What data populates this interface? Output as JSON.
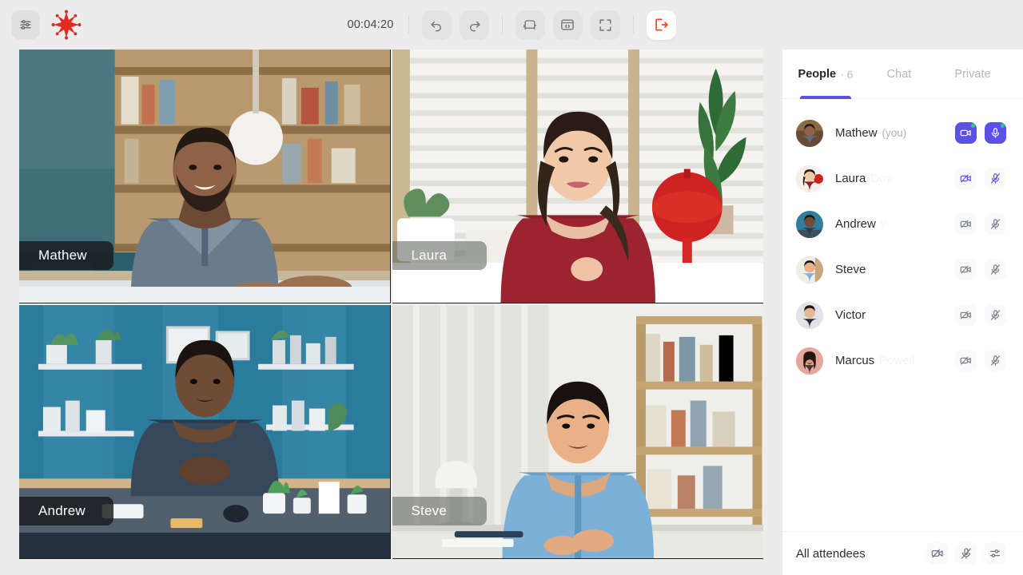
{
  "toolbar": {
    "settings_icon": "sliders-icon",
    "logo_icon": "brand-logo-icon",
    "timer": "00:04:20",
    "undo_label": "undo-icon",
    "redo_label": "redo-icon",
    "lounge_label": "sofa-icon",
    "embed_label": "code-window-icon",
    "fullscreen_label": "fullscreen-icon",
    "exit_label": "exit-icon",
    "accent_red": "#f4421a",
    "logo_red": "#e02b20"
  },
  "stage": {
    "tiles": [
      {
        "name": "Mathew",
        "pill_style": "dark"
      },
      {
        "name": "Laura",
        "pill_style": "translucent"
      },
      {
        "name": "Andrew",
        "pill_style": "dark"
      },
      {
        "name": "Steve",
        "pill_style": "translucent"
      }
    ]
  },
  "panel": {
    "tabs": [
      {
        "label": "People",
        "count": "· 6",
        "active": true
      },
      {
        "label": "Chat",
        "count": "",
        "active": false
      },
      {
        "label": "Private",
        "count": "",
        "active": false
      }
    ],
    "accent_purple": "#5b50e8",
    "people": [
      {
        "name": "Mathew",
        "suffix": "(you)",
        "surname": "",
        "cam_on": true,
        "mic_on": true,
        "icon_tone": "white"
      },
      {
        "name": "Laura",
        "suffix": "",
        "surname": "Doy",
        "cam_on": false,
        "mic_on": false,
        "icon_tone": "purple"
      },
      {
        "name": "Andrew",
        "suffix": "",
        "surname": "y",
        "cam_on": false,
        "mic_on": false,
        "icon_tone": "gray"
      },
      {
        "name": "Steve",
        "suffix": "",
        "surname": "",
        "cam_on": false,
        "mic_on": false,
        "icon_tone": "gray"
      },
      {
        "name": "Victor",
        "suffix": "",
        "surname": "",
        "cam_on": false,
        "mic_on": false,
        "icon_tone": "gray"
      },
      {
        "name": "Marcus",
        "suffix": "",
        "surname": "Powell",
        "cam_on": false,
        "mic_on": false,
        "icon_tone": "gray"
      }
    ],
    "footer": {
      "label": "All attendees",
      "cam_off_icon": "camera-off-icon",
      "mic_off_icon": "mic-off-icon",
      "settings_icon": "sliders-icon"
    }
  }
}
